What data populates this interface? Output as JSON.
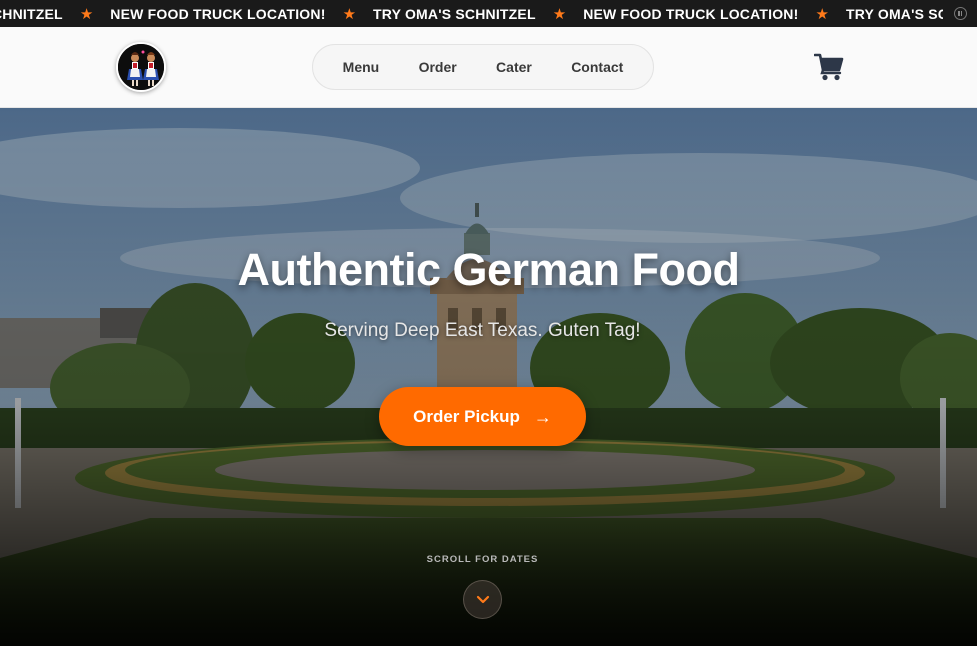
{
  "ticker": {
    "items": [
      "CHNITZEL",
      "NEW FOOD TRUCK LOCATION!",
      "TRY OMA'S SCHNITZEL",
      "NEW FOOD TRUCK LOCATION!",
      "TRY OMA'S SCH"
    ],
    "star": "★"
  },
  "nav": {
    "items": [
      "Menu",
      "Order",
      "Cater",
      "Contact"
    ]
  },
  "hero": {
    "title": "Authentic German Food",
    "subtitle": "Serving Deep East Texas. Guten Tag!",
    "cta_label": "Order Pickup",
    "cta_arrow": "→",
    "scroll_label": "SCROLL FOR DATES"
  },
  "colors": {
    "accent": "#ff6a00",
    "star": "#ff7a1a",
    "cart": "#2d3748",
    "ticker_bg": "#1a1a1a"
  },
  "icons": [
    "star-icon",
    "pause-icon",
    "logo",
    "cart-icon",
    "arrow-right-icon",
    "chevron-down-icon"
  ]
}
